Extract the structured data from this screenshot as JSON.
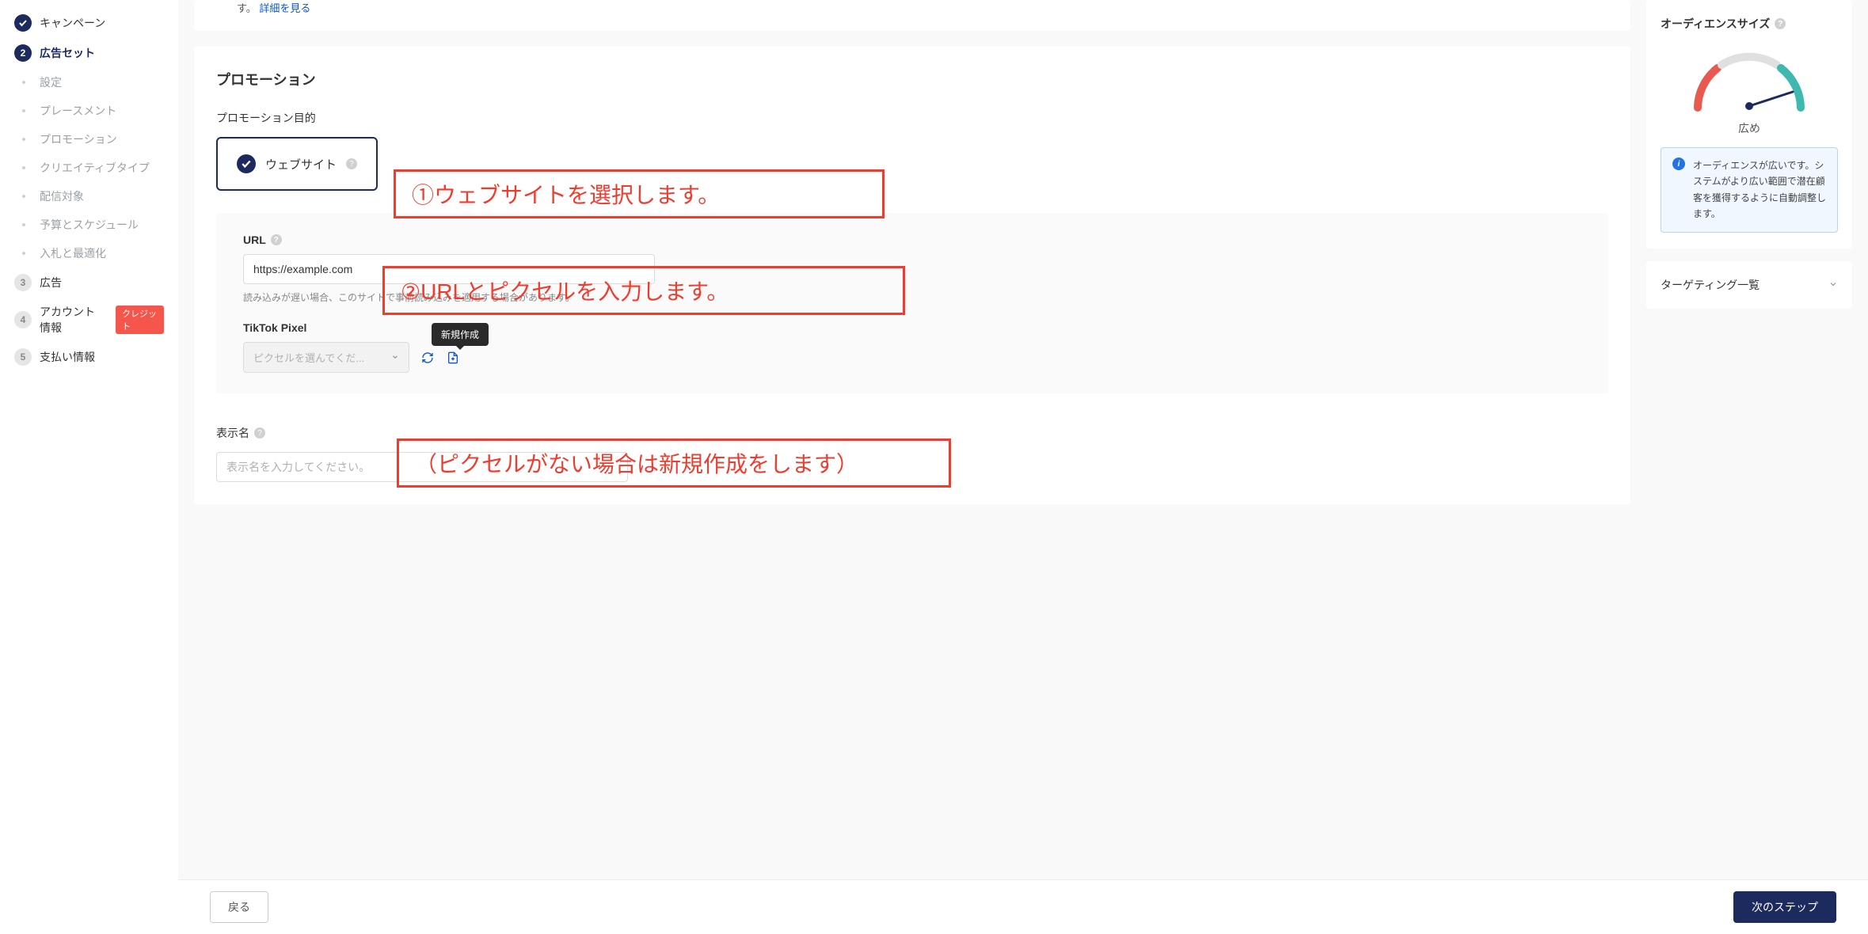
{
  "sidebar": {
    "steps": [
      {
        "label": "キャンペーン",
        "state": "done"
      },
      {
        "label": "広告セット",
        "state": "active"
      },
      {
        "label": "広告",
        "state": "pending",
        "num": "3"
      },
      {
        "label": "アカウント情報",
        "state": "pending",
        "num": "4",
        "badge": "クレジット"
      },
      {
        "label": "支払い情報",
        "state": "pending",
        "num": "5"
      }
    ],
    "substeps": [
      "設定",
      "プレースメント",
      "プロモーション",
      "クリエイティブタイプ",
      "配信対象",
      "予算とスケジュール",
      "入札と最適化"
    ]
  },
  "top_note_prefix": "す。",
  "top_note_link": "詳細を見る",
  "promotion": {
    "title": "プロモーション",
    "purpose_label": "プロモーション目的",
    "website_label": "ウェブサイト",
    "url_label": "URL",
    "url_value": "https://example.com",
    "url_hint": "読み込みが遅い場合、このサイトで事前読み込みを適用する場合があります。",
    "pixel_label": "TikTok Pixel",
    "pixel_placeholder": "ピクセルを選んでくだ...",
    "tooltip_new": "新規作成",
    "display_name_label": "表示名",
    "display_name_placeholder": "表示名を入力してください。"
  },
  "annotations": {
    "a1": "①ウェブサイトを選択します。",
    "a2": "②URLとピクセルを入力します。",
    "a3": "（ピクセルがない場合は新規作成をします）"
  },
  "right": {
    "audience_title": "オーディエンスサイズ",
    "gauge_label": "広め",
    "info_text": "オーディエンスが広いです。システムがより広い範囲で潜在顧客を獲得するように自動調整します。",
    "targeting_title": "ターゲティング一覧"
  },
  "footer": {
    "back": "戻る",
    "next": "次のステップ"
  }
}
